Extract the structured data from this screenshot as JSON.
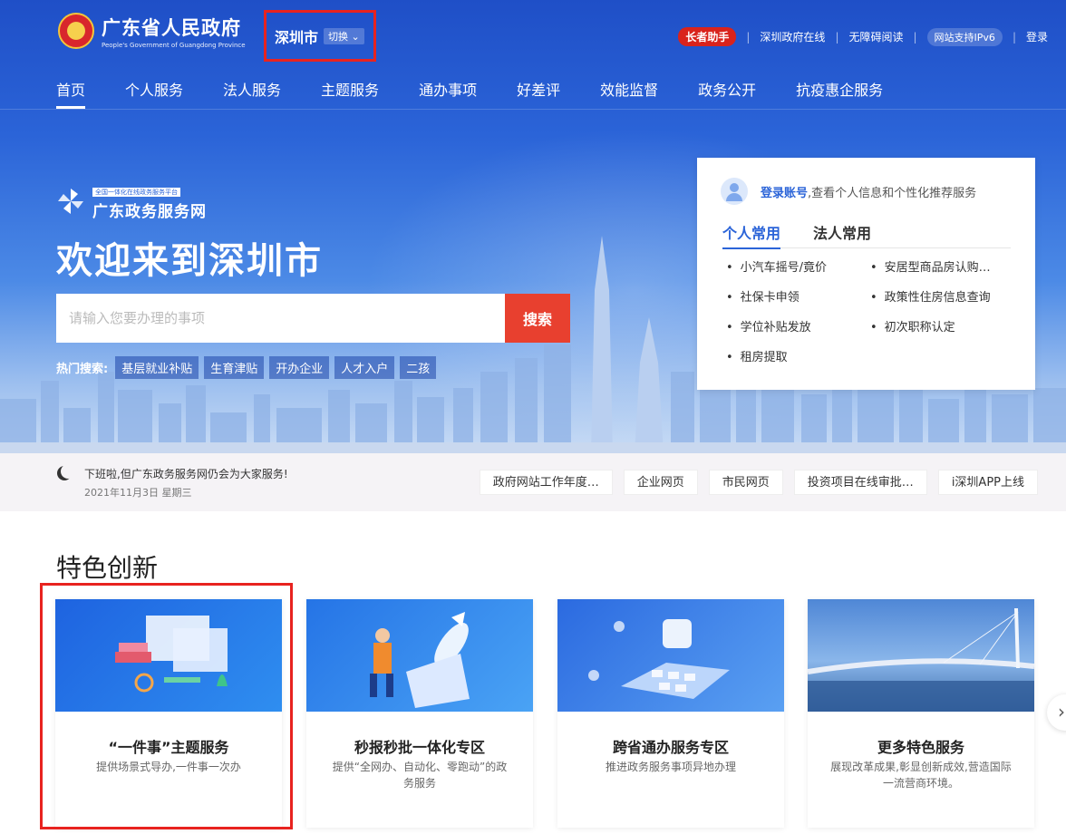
{
  "header": {
    "logo_title": "广东省人民政府",
    "logo_subtitle": "People's Government of Guangdong Province",
    "city": "深圳市",
    "city_switch": "切换",
    "top_links": [
      "长者助手",
      "深圳政府在线",
      "无障碍阅读",
      "网站支持IPv6",
      "登录"
    ]
  },
  "nav": {
    "items": [
      "首页",
      "个人服务",
      "法人服务",
      "主题服务",
      "通办事项",
      "好差评",
      "效能监督",
      "政务公开",
      "抗疫惠企服务"
    ],
    "active_index": 0
  },
  "hero": {
    "portal_tag": "全国一体化在线政务服务平台",
    "portal_name": "广东政务服务网",
    "welcome": "欢迎来到深圳市",
    "search_placeholder": "请输入您要办理的事项",
    "search_button": "搜索",
    "hot_label": "热门搜索:",
    "hot_tags": [
      "基层就业补贴",
      "生育津贴",
      "开办企业",
      "人才入户",
      "二孩"
    ]
  },
  "login_card": {
    "login_link": "登录账号",
    "login_text": ",查看个人信息和个性化推荐服务",
    "tabs": [
      "个人常用",
      "法人常用"
    ],
    "active_tab": 0,
    "items": [
      "小汽车摇号/竟价",
      "安居型商品房认购…",
      "社保卡申领",
      "政策性住房信息查询",
      "学位补贴发放",
      "初次职称认定",
      "租房提取"
    ]
  },
  "notice": {
    "text": "下班啦,但广东政务服务网仍会为大家服务!",
    "date": "2021年11月3日 星期三",
    "quick_links": [
      "政府网站工作年度…",
      "企业网页",
      "市民网页",
      "投资项目在线审批…",
      "i深圳APP上线"
    ]
  },
  "features": {
    "title": "特色创新",
    "cards": [
      {
        "title": "“一件事”主题服务",
        "desc": "提供场景式导办,一件事一次办"
      },
      {
        "title": "秒报秒批一体化专区",
        "desc": "提供“全网办、自动化、零跑动”的政务服务"
      },
      {
        "title": "跨省通办服务专区",
        "desc": "推进政务服务事项异地办理"
      },
      {
        "title": "更多特色服务",
        "desc": "展现改革成果,彰显创新成效,营造国际一流营商环境。"
      }
    ]
  },
  "colors": {
    "brand_blue": "#2b64d8",
    "accent_red": "#e8402f",
    "highlight_box": "#e8231f"
  }
}
